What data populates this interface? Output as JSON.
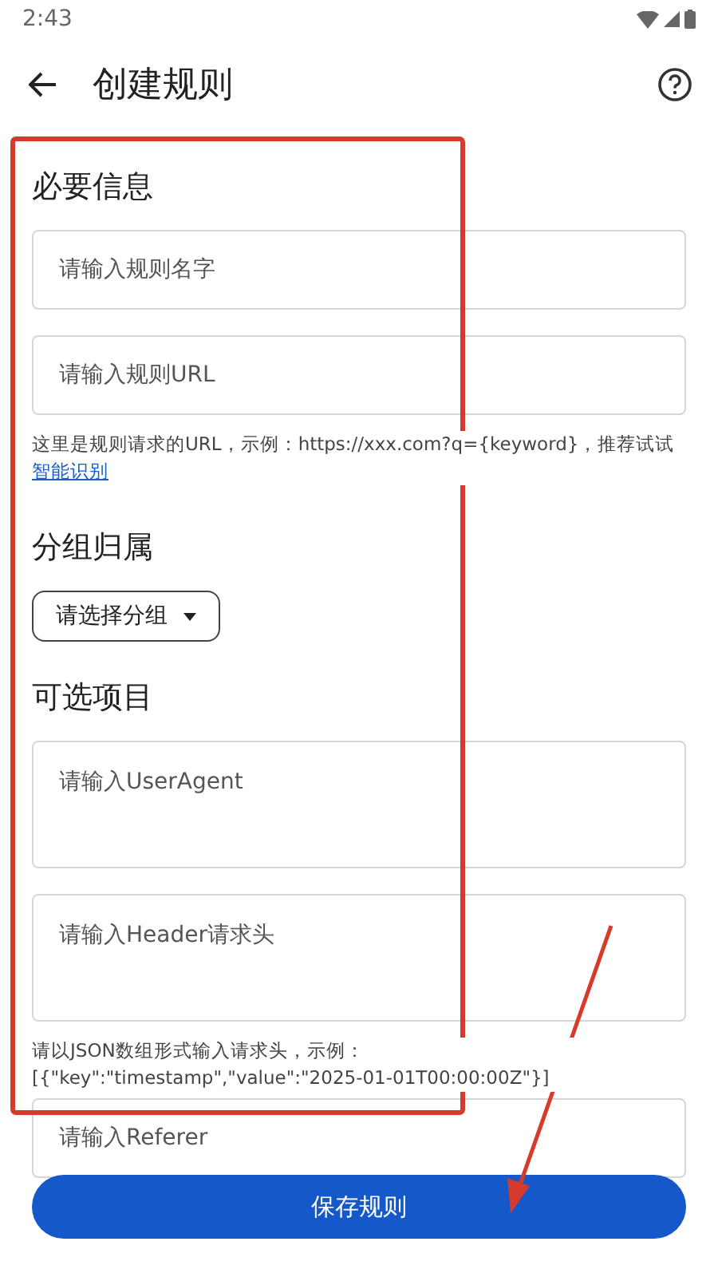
{
  "status_bar": {
    "time": "2:43"
  },
  "app_bar": {
    "title": "创建规则"
  },
  "sections": [
    {
      "heading": "必要信息",
      "items": [
        {
          "kind": "field",
          "placeholder": "请输入规则名字"
        },
        {
          "kind": "field",
          "placeholder": "请输入规则URL"
        },
        {
          "kind": "helper",
          "text": "这里是规则请求的URL，示例：https://xxx.com?q={keyword}，推荐试试",
          "link": "智能识别"
        }
      ]
    },
    {
      "heading": "分组归属",
      "items": [
        {
          "kind": "dropdown",
          "label": "请选择分组"
        }
      ]
    },
    {
      "heading": "可选项目",
      "items": [
        {
          "kind": "textarea",
          "placeholder": "请输入UserAgent"
        },
        {
          "kind": "textarea",
          "placeholder": "请输入Header请求头"
        },
        {
          "kind": "helper",
          "text": "请以JSON数组形式输入请求头，示例：[{\"key\":\"timestamp\",\"value\":\"2025-01-01T00:00:00Z\"}]"
        },
        {
          "kind": "field",
          "placeholder": "请输入Referer"
        }
      ]
    }
  ],
  "save_button": "保存规则"
}
